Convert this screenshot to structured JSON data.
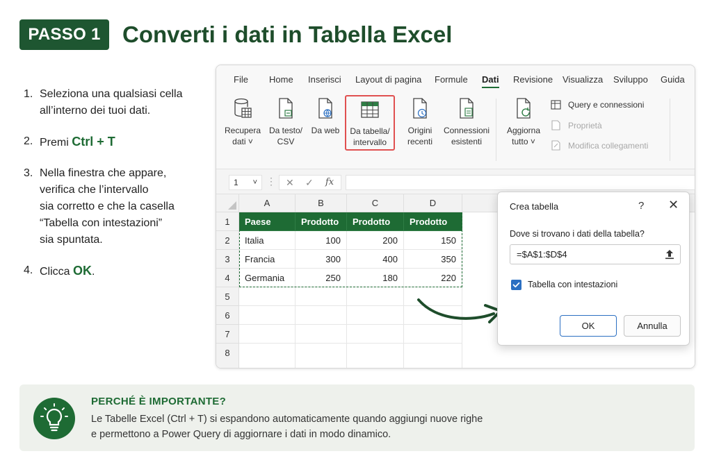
{
  "header": {
    "badge": "PASSO 1",
    "title": "Converti i dati in Tabella Excel"
  },
  "steps": [
    {
      "num": "1.",
      "lines": [
        "Seleziona una qualsiasi cella",
        "all’interno dei tuoi dati."
      ]
    },
    {
      "num": "2.",
      "prefix": "Premi ",
      "key": "Ctrl + T"
    },
    {
      "num": "3.",
      "lines": [
        "Nella finestra che appare,",
        "verifica che l’intervallo",
        "sia corretto e che la casella",
        "“Tabella con intestazioni”",
        "sia spuntata."
      ]
    },
    {
      "num": "4.",
      "prefix": "Clicca ",
      "key": "OK",
      "suffix": "."
    }
  ],
  "menu": [
    "File",
    "Home",
    "Inserisci",
    "Layout di pagina",
    "Formule",
    "Dati",
    "Revisione",
    "Visualizza",
    "Sviluppo",
    "Guida"
  ],
  "menu_active": "Dati",
  "ribbon": {
    "recupera": [
      "Recupera",
      "dati ˅"
    ],
    "testo": [
      "Da testo/",
      "CSV"
    ],
    "web": [
      "Da web"
    ],
    "tabella": [
      "Da tabella/",
      "intervallo"
    ],
    "origini": [
      "Origini",
      "recenti"
    ],
    "connessioni": [
      "Connessioni",
      "esistenti"
    ],
    "aggiorna": [
      "Aggiorna",
      "tutto ˅"
    ],
    "side": {
      "query": "Query e connessioni",
      "proprieta": "Proprietà",
      "modifica": "Modifica collegamenti"
    }
  },
  "formula_bar": {
    "namebox": "1",
    "chev": "˅",
    "dots": "⋮",
    "cancel": "✕",
    "confirm": "✓",
    "fx": "fx"
  },
  "sheet": {
    "columns": [
      "A",
      "B",
      "C",
      "D"
    ],
    "rows": [
      "1",
      "2",
      "3",
      "4",
      "5",
      "6",
      "7",
      "8"
    ],
    "table_header": [
      "Paese",
      "Prodotto A",
      "Prodotto B",
      "Prodotto C"
    ],
    "table_rows": [
      [
        "Italia",
        "100",
        "200",
        "150"
      ],
      [
        "Francia",
        "300",
        "400",
        "350"
      ],
      [
        "Germania",
        "250",
        "180",
        "220"
      ]
    ]
  },
  "dialog": {
    "title": "Crea tabella",
    "help": "?",
    "close": "✕",
    "question": "Dove si trovano i dati della tabella?",
    "range": "=$A$1:$D$4",
    "checkbox_label": "Tabella con intestazioni",
    "checkbox_checked": true,
    "ok": "OK",
    "cancel": "Annulla"
  },
  "info": {
    "heading": "PERCHÉ È IMPORTANTE?",
    "line1": "Le Tabelle Excel (Ctrl + T) si espandono automaticamente quando aggiungi nuove righe",
    "line2": "e permettono a Power Query di aggiornare i dati in modo dinamico."
  },
  "colors": {
    "accent": "#1e6b34",
    "highlight": "#e05050",
    "checkbox": "#2b6fc2"
  }
}
